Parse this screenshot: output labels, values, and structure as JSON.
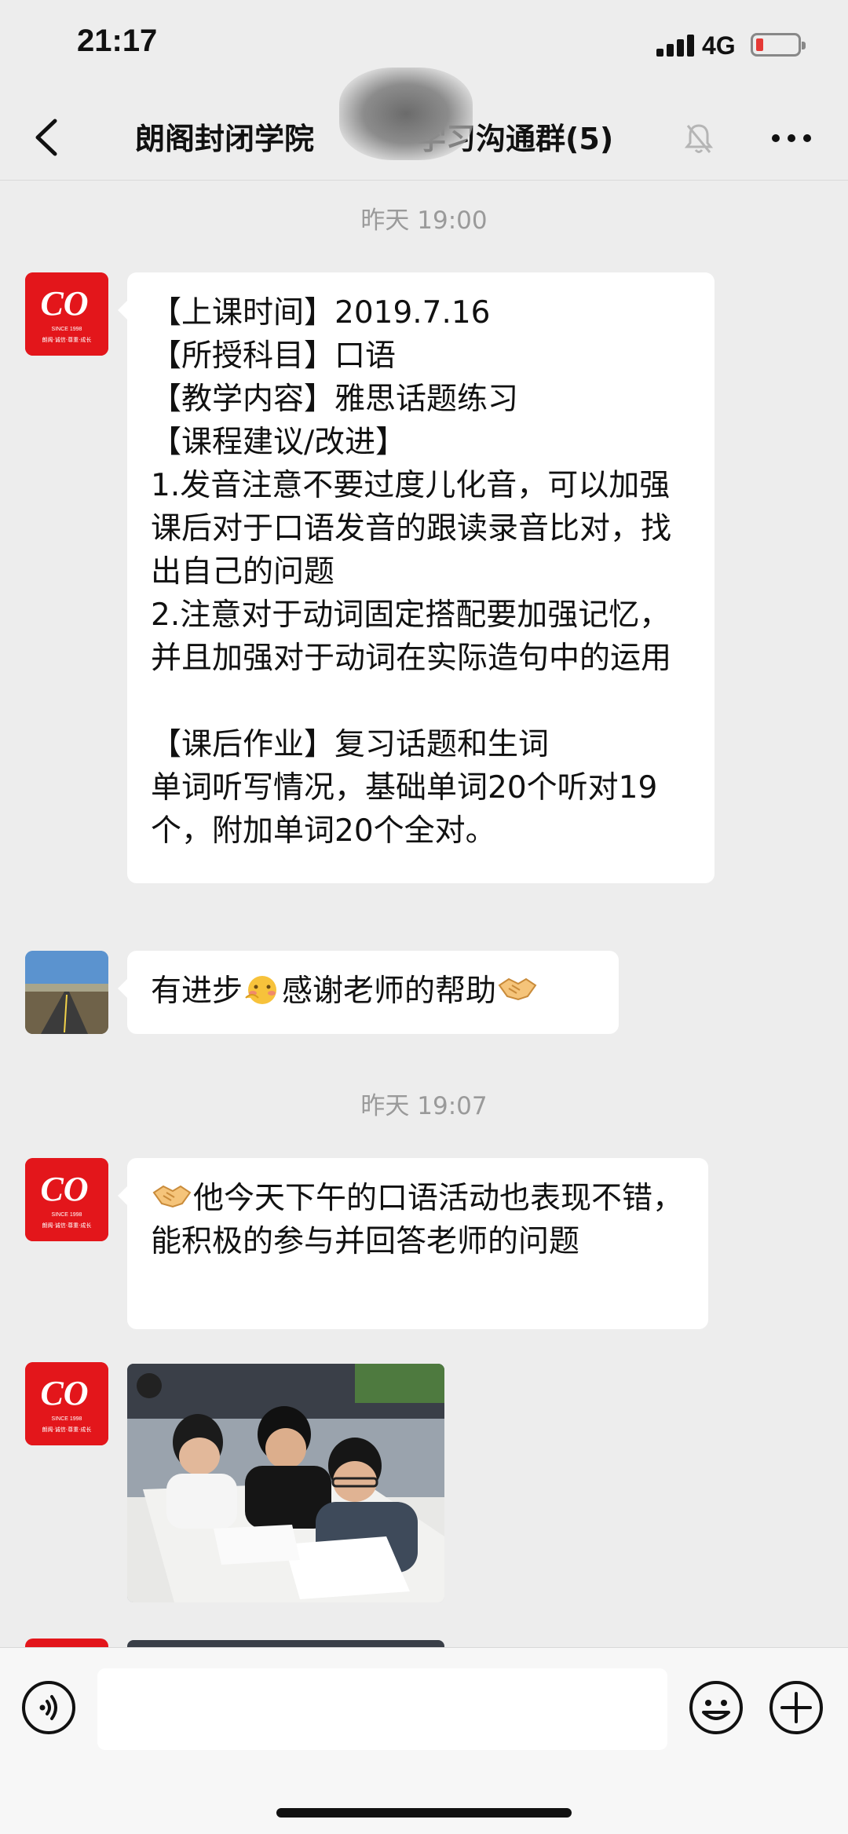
{
  "status_bar": {
    "time": "21:17",
    "network": "4G",
    "battery_color": "#e53935"
  },
  "nav": {
    "title_part1": "朗阁封闭学院",
    "title_part2": "学习沟通群(5)",
    "back_icon": "chevron-left-icon",
    "mute_icon": "bell-mute-icon",
    "more_icon": "more-dots-icon"
  },
  "chat": {
    "timestamp_1": "昨天 19:00",
    "timestamp_2": "昨天 19:07",
    "messages": [
      {
        "sender": "logo-avatar",
        "text": "【上课时间】2019.7.16\n【所授科目】口语\n【教学内容】雅思话题练习\n【课程建议/改进】\n1.发音注意不要过度儿化音，可以加强课后对于口语发音的跟读录音比对，找出自己的问题\n2.注意对于动词固定搭配要加强记忆，并且加强对于动词在实际造句中的运用\n\n【课后作业】复习话题和生词\n单词听写情况，基础单词20个听对19个，附加单词20个全对。"
      },
      {
        "sender": "road-avatar",
        "text_a": "有进步",
        "text_b": "感谢老师的帮助"
      },
      {
        "sender": "logo-avatar",
        "text": "他今天下午的口语活动也表现不错，能积极的参与并回答老师的问题"
      },
      {
        "sender": "logo-avatar",
        "type": "photo"
      }
    ]
  },
  "logo": {
    "main": "CO",
    "sub": "SINCE 1998",
    "tagline": "朗阁·诚信·尊重·成长"
  },
  "input_bar": {
    "placeholder": "",
    "voice_icon": "voice-icon",
    "emoji_icon": "emoji-icon",
    "plus_icon": "plus-icon"
  }
}
